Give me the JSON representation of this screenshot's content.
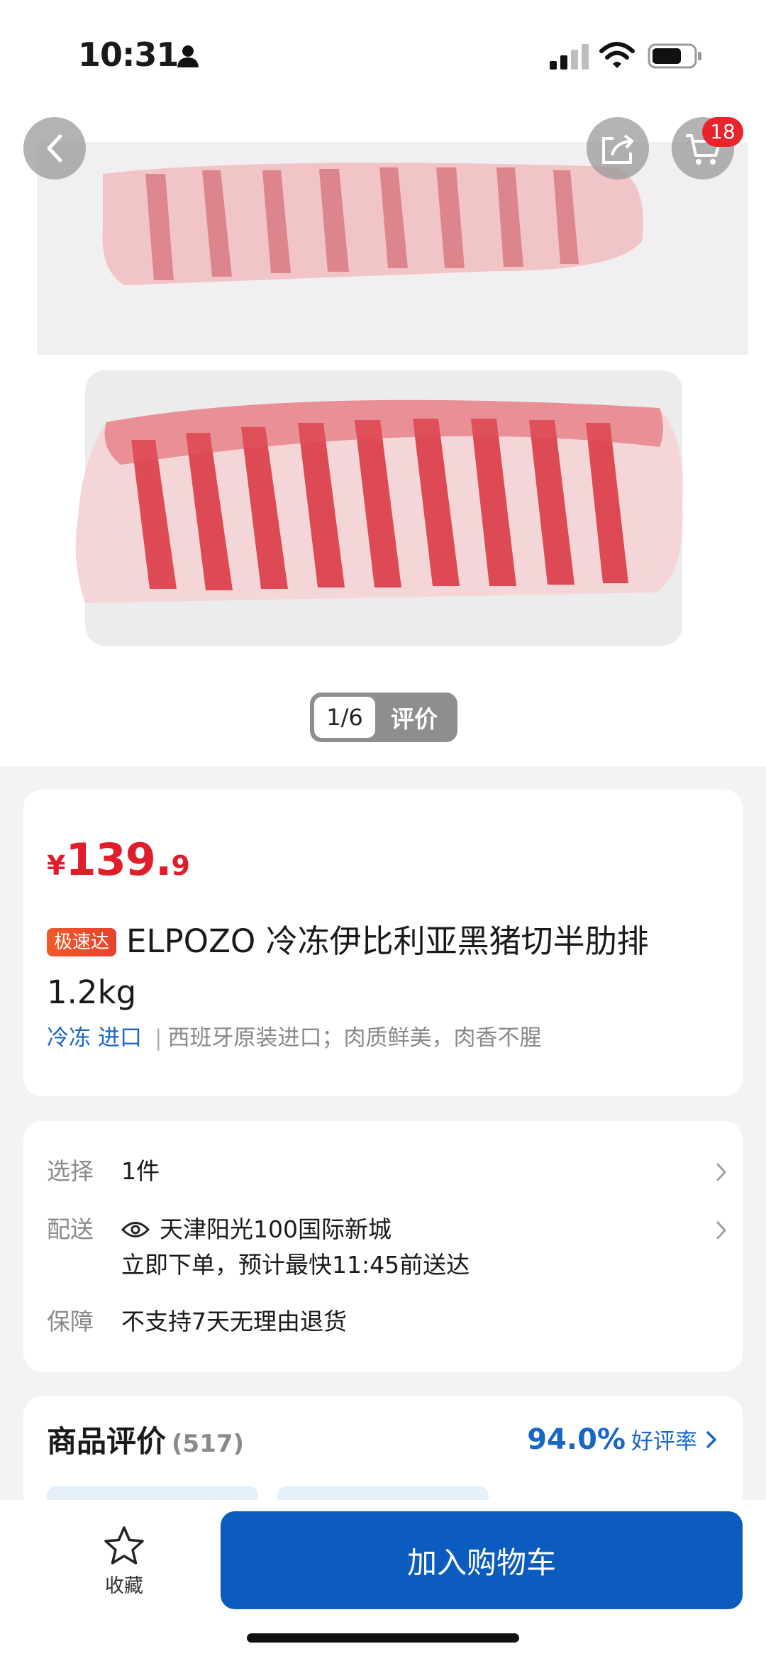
{
  "status_bar": {
    "time": "10:31"
  },
  "gallery": {
    "cart_badge": "18",
    "pager_count": "1/6",
    "pager_review_label": "评价"
  },
  "product": {
    "price_currency": "¥",
    "price_integer": "139.",
    "price_decimal": "9",
    "badge": "极速达",
    "title": "ELPOZO 冷冻伊比利亚黑猪切半肋排1.2kg",
    "tag_frozen": "冷冻",
    "tag_import": "进口",
    "tag_separator": "|",
    "description": "西班牙原装进口；肉质鲜美，肉香不腥"
  },
  "options": {
    "select_label": "选择",
    "select_value": "1件",
    "delivery_label": "配送",
    "delivery_address": "天津阳光100国际新城",
    "delivery_eta": "立即下单，预计最快11:45前送达",
    "guarantee_label": "保障",
    "guarantee_value": "不支持7天无理由退货"
  },
  "reviews": {
    "title": "商品评价",
    "count": "(517)",
    "rate": "94.0%",
    "rate_label": "好评率"
  },
  "bottom_bar": {
    "favorite_label": "收藏",
    "add_to_cart_label": "加入购物车"
  },
  "colors": {
    "price_red": "#e01e2b",
    "brand_blue": "#0c5cbf",
    "link_blue": "#1866c6",
    "badge_red": "#e8232b"
  },
  "icons": [
    "person-icon",
    "signal-icon",
    "wifi-icon",
    "battery-icon",
    "back-arrow-icon",
    "share-icon",
    "cart-icon",
    "eye-icon",
    "chevron-right-icon",
    "star-icon"
  ]
}
